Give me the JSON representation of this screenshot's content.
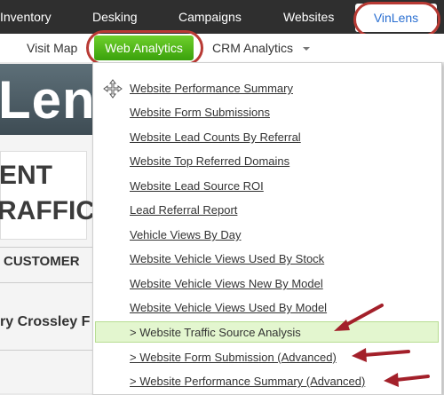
{
  "topnav": {
    "items": [
      "Inventory",
      "Desking",
      "Campaigns",
      "Websites"
    ],
    "active": "VinLens"
  },
  "subnav": {
    "visit_map": "Visit Map",
    "web_analytics": "Web Analytics",
    "crm_analytics": "CRM Analytics"
  },
  "page": {
    "logo_text": "Lens",
    "banner_line1": "ENT",
    "banner_line2": "RAFFIC:",
    "customer": "CUSTOMER",
    "name": "ry Crossley F"
  },
  "menu": {
    "items": [
      "Website Performance Summary",
      "Website Form Submissions",
      "Website Lead Counts By Referral",
      "Website Top Referred Domains",
      "Website Lead Source ROI",
      "Lead Referral Report",
      "Vehicle Views By Day",
      "Website Vehicle Views Used By Stock",
      "Website Vehicle Views New By Model",
      "Website Vehicle Views Used By Model",
      "> Website Traffic Source Analysis",
      "> Website Form Submission (Advanced)",
      "> Website Performance Summary (Advanced)"
    ]
  },
  "colors": {
    "annotation": "#b83a34",
    "active_green": "#4db71a",
    "highlight": "#e3f6cf"
  },
  "icons": {
    "move": "move-icon",
    "chevron": "chevron-down-icon"
  }
}
